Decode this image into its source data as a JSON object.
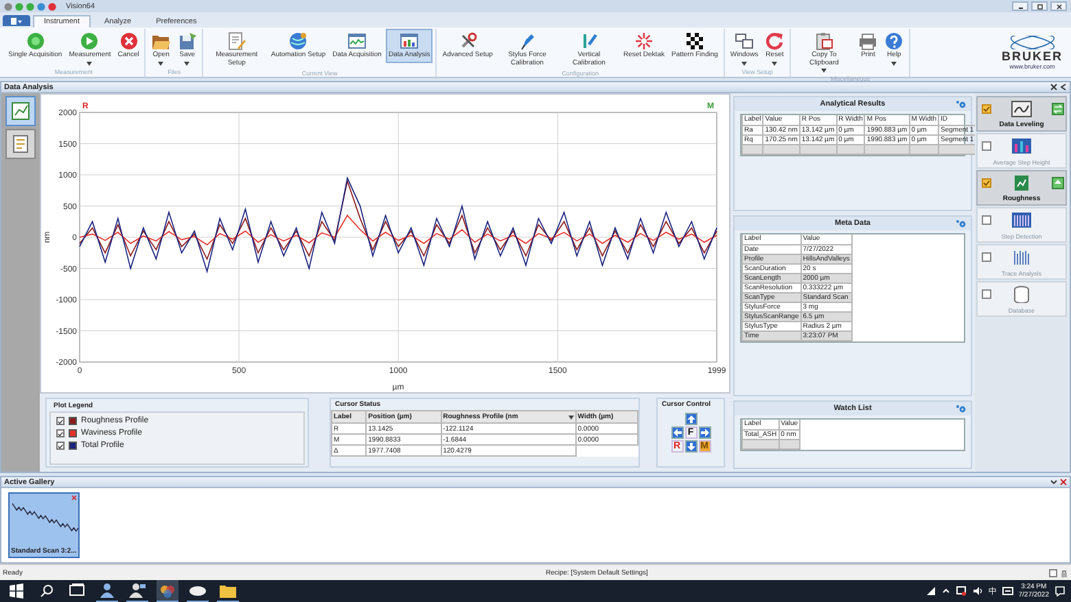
{
  "window": {
    "title": "Vision64"
  },
  "tabs": [
    {
      "label": "Instrument",
      "selected": true
    },
    {
      "label": "Analyze",
      "selected": false
    },
    {
      "label": "Preferences",
      "selected": false
    }
  ],
  "ribbon": {
    "groups": [
      {
        "label": "Measurement",
        "buttons": [
          {
            "label": "Single Acquisition",
            "selected": false,
            "dropdown": false
          },
          {
            "label": "Measurement",
            "selected": false,
            "dropdown": true
          },
          {
            "label": "Cancel",
            "selected": false,
            "dropdown": false
          }
        ]
      },
      {
        "label": "Files",
        "buttons": [
          {
            "label": "Open",
            "selected": false,
            "dropdown": true
          },
          {
            "label": "Save",
            "selected": false,
            "dropdown": true
          }
        ]
      },
      {
        "label": "Current View",
        "buttons": [
          {
            "label": "Measurement Setup",
            "selected": false,
            "dropdown": false
          },
          {
            "label": "Automation Setup",
            "selected": false,
            "dropdown": false
          },
          {
            "label": "Data Acquisition",
            "selected": false,
            "dropdown": false
          },
          {
            "label": "Data Analysis",
            "selected": true,
            "dropdown": false
          }
        ]
      },
      {
        "label": "Configuration",
        "buttons": [
          {
            "label": "Advanced Setup",
            "selected": false,
            "dropdown": false
          },
          {
            "label": "Stylus Force Calibration",
            "selected": false,
            "dropdown": false
          },
          {
            "label": "Vertical Calibration",
            "selected": false,
            "dropdown": false
          },
          {
            "label": "Reset Dektak",
            "selected": false,
            "dropdown": false
          },
          {
            "label": "Pattern Finding",
            "selected": false,
            "dropdown": false
          }
        ]
      },
      {
        "label": "View Setup",
        "buttons": [
          {
            "label": "Windows",
            "selected": false,
            "dropdown": true
          },
          {
            "label": "Reset",
            "selected": false,
            "dropdown": true
          }
        ]
      },
      {
        "label": "Miscellaneous",
        "buttons": [
          {
            "label": "Copy To Clipboard",
            "selected": false,
            "dropdown": true
          },
          {
            "label": "Print",
            "selected": false,
            "dropdown": false
          },
          {
            "label": "Help",
            "selected": false,
            "dropdown": true
          }
        ]
      }
    ]
  },
  "logo": {
    "name": "BRUKER",
    "url": "www.bruker.com"
  },
  "panel": {
    "title": "Data Analysis"
  },
  "side_tools": [
    {
      "selected": true
    },
    {
      "selected": false
    }
  ],
  "chart": {
    "cursors": [
      {
        "label": "R",
        "color": "#e02020"
      },
      {
        "label": "M",
        "color": "#3a9a3a"
      }
    ],
    "chart_data": {
      "type": "line",
      "grid": true,
      "xlabel": "µm",
      "ylabel": "nm",
      "x": [
        0,
        40,
        80,
        120,
        160,
        200,
        240,
        280,
        320,
        360,
        400,
        440,
        480,
        520,
        560,
        600,
        640,
        680,
        720,
        760,
        800,
        840,
        880,
        920,
        960,
        1000,
        1040,
        1080,
        1120,
        1160,
        1200,
        1240,
        1280,
        1320,
        1360,
        1400,
        1440,
        1480,
        1520,
        1560,
        1600,
        1640,
        1680,
        1720,
        1760,
        1800,
        1840,
        1880,
        1920,
        1960,
        1999
      ],
      "series": [
        {
          "color": "#8b1a1a",
          "values": [
            -100,
            150,
            -250,
            200,
            -300,
            100,
            -200,
            250,
            -150,
            50,
            -350,
            200,
            -100,
            300,
            -250,
            150,
            -200,
            100,
            -300,
            250,
            -50,
            900,
            300,
            -200,
            250,
            -150,
            100,
            -300,
            200,
            -100,
            350,
            -250,
            150,
            -200,
            100,
            -300,
            200,
            -50,
            250,
            -200,
            150,
            -300,
            100,
            -250,
            200,
            -150,
            250,
            -100,
            150,
            -250,
            100
          ]
        },
        {
          "color": "#e8302a",
          "values": [
            0,
            50,
            -50,
            80,
            -100,
            20,
            -60,
            90,
            -40,
            10,
            -120,
            60,
            -30,
            100,
            -80,
            40,
            -60,
            30,
            -90,
            70,
            0,
            350,
            120,
            -60,
            80,
            -50,
            30,
            -100,
            60,
            -30,
            120,
            -80,
            50,
            -60,
            30,
            -100,
            60,
            -20,
            80,
            -60,
            50,
            -100,
            30,
            -80,
            60,
            -50,
            80,
            -30,
            50,
            -80,
            30
          ]
        },
        {
          "color": "#1a237e",
          "values": [
            -150,
            250,
            -400,
            300,
            -500,
            150,
            -350,
            400,
            -250,
            100,
            -550,
            300,
            -200,
            450,
            -400,
            250,
            -300,
            150,
            -500,
            400,
            -100,
            950,
            500,
            -300,
            350,
            -250,
            150,
            -450,
            300,
            -150,
            500,
            -350,
            250,
            -300,
            150,
            -450,
            300,
            -100,
            400,
            -300,
            250,
            -450,
            150,
            -350,
            300,
            -250,
            400,
            -150,
            250,
            -350,
            150
          ]
        }
      ],
      "xlim": [
        0,
        1999
      ],
      "ylim": [
        -2000,
        2000
      ],
      "xticks": [
        0,
        500,
        1000,
        1500,
        1999
      ],
      "yticks": [
        -2000,
        -1500,
        -1000,
        -500,
        0,
        500,
        1000,
        1500,
        2000
      ]
    }
  },
  "plot_legend": {
    "title": "Plot Legend",
    "items": [
      {
        "label": "Roughness Profile",
        "checked": true,
        "color": "#8b1a1a"
      },
      {
        "label": "Waviness Profile",
        "checked": true,
        "color": "#e8302a"
      },
      {
        "label": "Total Profile",
        "checked": true,
        "color": "#1a237e"
      }
    ]
  },
  "cursor_status": {
    "title": "Cursor Status",
    "columns": [
      {
        "label": "Label",
        "dropdown": false
      },
      {
        "label": "Position (µm)",
        "dropdown": false
      },
      {
        "label": "Roughness Profile (nm",
        "dropdown": true
      },
      {
        "label": "Width (µm)",
        "dropdown": false
      }
    ],
    "rows": [
      [
        "R",
        "13.1425",
        "-122.1124",
        "0.0000"
      ],
      [
        "M",
        "1990.8833",
        "-1.6844",
        "0.0000"
      ],
      [
        "Δ",
        "1977.7408",
        "120.4279"
      ]
    ]
  },
  "cursor_control": {
    "title": "Cursor Control",
    "buttons": [
      {
        "kind": "up"
      },
      {
        "kind": "left"
      },
      {
        "kind": "label",
        "label": "F",
        "selected": false
      },
      {
        "kind": "right"
      },
      {
        "kind": "label",
        "label": "R",
        "selected": false
      },
      {
        "kind": "down"
      },
      {
        "kind": "label",
        "label": "M",
        "selected": true
      }
    ]
  },
  "analytical_results": {
    "title": "Analytical Results",
    "columns": [
      "Label",
      "Value",
      "R Pos",
      "R Width",
      "M Pos",
      "M Width",
      "ID"
    ],
    "rows": [
      [
        "Ra",
        "130.42 nm",
        "13.142 µm",
        "0 µm",
        "1990.883 µm",
        "0 µm",
        "Segment 1"
      ],
      [
        "Rq",
        "170.25 nm",
        "13.142 µm",
        "0 µm",
        "1990.883 µm",
        "0 µm",
        "Segment 1"
      ]
    ]
  },
  "meta_data": {
    "title": "Meta Data",
    "columns": [
      "Label",
      "Value"
    ],
    "rows": [
      [
        "Date",
        "7/27/2022"
      ],
      [
        "Profile",
        "HillsAndValleys"
      ],
      [
        "ScanDuration",
        "20 s"
      ],
      [
        "ScanLength",
        "2000 µm"
      ],
      [
        "ScanResolution",
        "0.333222 µm"
      ],
      [
        "ScanType",
        "Standard Scan"
      ],
      [
        "StylusForce",
        "3 mg"
      ],
      [
        "StylusScanRange",
        "6.5 µm"
      ],
      [
        "StylusType",
        "Radius 2 µm"
      ],
      [
        "Time",
        "3:23:07 PM"
      ]
    ]
  },
  "watch_list": {
    "title": "Watch List",
    "columns": [
      "Label",
      "Value"
    ],
    "rows": [
      [
        "Total_ASH",
        "0 nm"
      ]
    ]
  },
  "analysis_tools": [
    {
      "label": "Data Leveling",
      "checked": true
    },
    {
      "label": "Average Step Height",
      "checked": false
    },
    {
      "label": "Roughness",
      "checked": true
    },
    {
      "label": "Step Detection",
      "checked": false
    },
    {
      "label": "Trace Analysis",
      "checked": false
    },
    {
      "label": "Database",
      "checked": false
    }
  ],
  "gallery": {
    "title": "Active Gallery",
    "items": [
      {
        "label": "Standard Scan 3:2...",
        "selected": true
      }
    ]
  },
  "status_bar": {
    "status": "Ready",
    "recipe": "Recipe: [System Default Settings]"
  },
  "taskbar": {
    "apps": [
      {
        "selected": false
      },
      {
        "selected": false
      },
      {
        "selected": true
      },
      {
        "selected": false
      },
      {
        "selected": false
      }
    ],
    "ime": "中",
    "time": "3:24 PM",
    "date": "7/27/2022"
  }
}
